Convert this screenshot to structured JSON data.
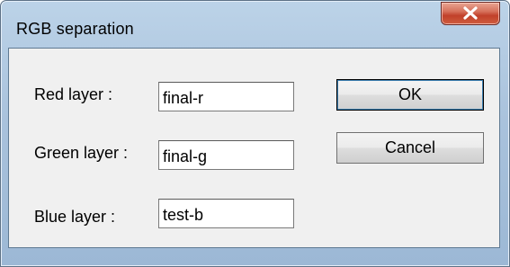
{
  "window": {
    "title": "RGB separation"
  },
  "fields": [
    {
      "label": "Red layer :",
      "value": "final-r"
    },
    {
      "label": "Green layer :",
      "value": "final-g"
    },
    {
      "label": "Blue layer :",
      "value": "test-b"
    }
  ],
  "buttons": {
    "ok_label": "OK",
    "cancel_label": "Cancel"
  },
  "colors": {
    "close_button": "#c1412a",
    "frame": "#a9c2dc",
    "client": "#f0f0f0"
  },
  "icons": {
    "close": "close-icon"
  }
}
